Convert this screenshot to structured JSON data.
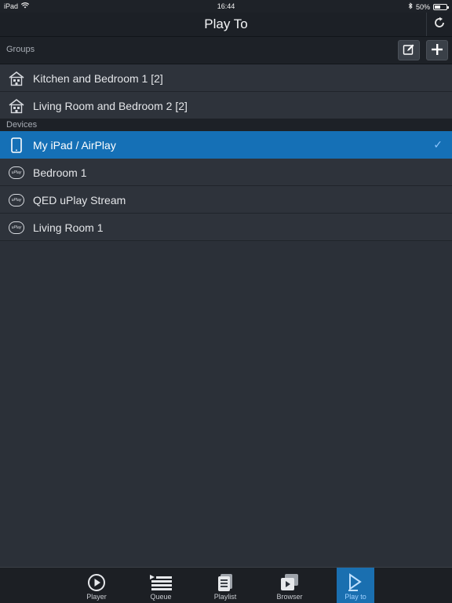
{
  "status_bar": {
    "device": "iPad",
    "time": "16:44",
    "battery": "50%",
    "battery_level": 0.5
  },
  "nav": {
    "title": "Play To"
  },
  "groups": {
    "header": "Groups",
    "items": [
      {
        "label": "Kitchen and Bedroom 1 [2]"
      },
      {
        "label": "Living Room and Bedroom 2 [2]"
      }
    ]
  },
  "devices": {
    "header": "Devices",
    "items": [
      {
        "label": "My iPad / AirPlay",
        "selected": true
      },
      {
        "label": "Bedroom 1"
      },
      {
        "label": "QED uPlay Stream"
      },
      {
        "label": "Living Room 1"
      }
    ]
  },
  "tabs": [
    {
      "label": "Player",
      "icon": "play-circle-icon"
    },
    {
      "label": "Queue",
      "icon": "queue-list-icon"
    },
    {
      "label": "Playlist",
      "icon": "playlist-icon"
    },
    {
      "label": "Browser",
      "icon": "browser-icon"
    },
    {
      "label": "Play to",
      "icon": "play-to-icon",
      "active": true
    }
  ],
  "colors": {
    "accent": "#1570b6",
    "background": "#2b3038"
  }
}
